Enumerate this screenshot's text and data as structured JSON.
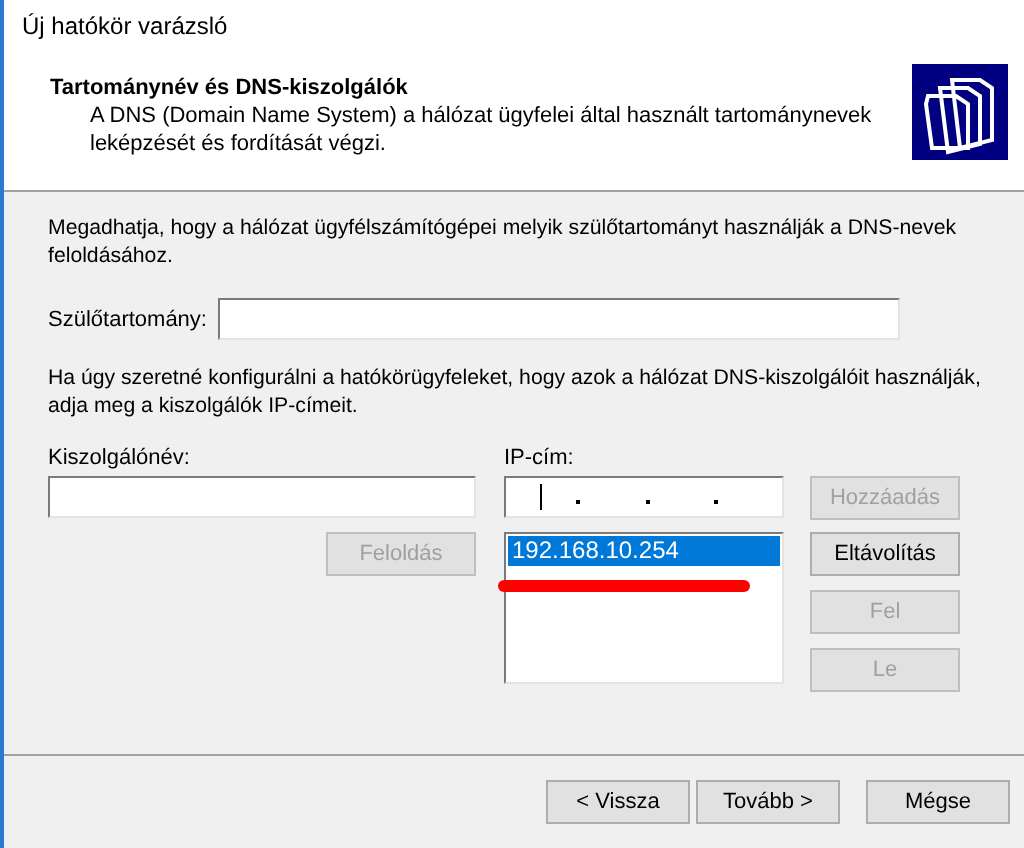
{
  "window": {
    "title": "Új hatókör varázsló"
  },
  "header": {
    "title": "Tartománynév és DNS-kiszolgálók",
    "subtitle": "A DNS (Domain Name System) a hálózat ügyfelei által használt tartománynevek leképzését és fordítását végzi."
  },
  "intro": "Megadhatja, hogy a hálózat ügyfélszámítógépei melyik szülőtartományt használják a DNS-nevek feloldásához.",
  "parent_domain": {
    "label": "Szülőtartomány:"
  },
  "dns_intro": "Ha úgy szeretné konfigurálni a hatókörügyfeleket, hogy azok a hálózat DNS-kiszolgálóit használják, adja meg a kiszolgálók IP-címeit.",
  "server_name": {
    "label": "Kiszolgálónév:"
  },
  "ip_address": {
    "label": "IP-cím:"
  },
  "resolve_button": {
    "label": "Feloldás",
    "disabled": true
  },
  "ip_list": [
    {
      "text": "192.168.10.254",
      "selected": true
    }
  ],
  "side_buttons": [
    {
      "label": "Hozzáadás",
      "disabled": true
    },
    {
      "label": "Eltávolítás",
      "disabled": false
    },
    {
      "label": "Fel",
      "disabled": true
    },
    {
      "label": "Le",
      "disabled": true
    }
  ],
  "footer_buttons": [
    {
      "label": "< Vissza",
      "disabled": false
    },
    {
      "label": "Tovább >",
      "disabled": false
    },
    {
      "label": "Mégse",
      "disabled": false
    }
  ]
}
